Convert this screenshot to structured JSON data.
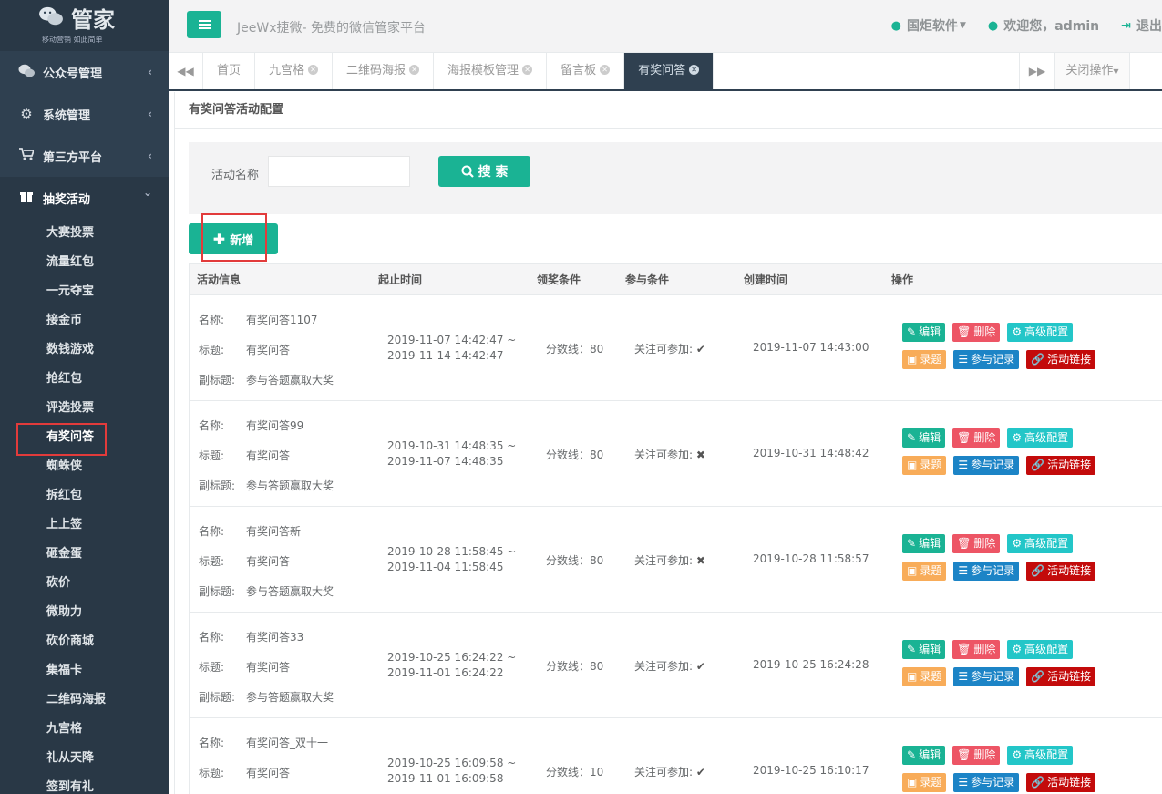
{
  "logo": {
    "brand": "管家",
    "sub": "移动营销 如此简单"
  },
  "sidebar": {
    "menus": [
      {
        "label": "公众号管理",
        "icon": "wechat-icon",
        "arrow": "‹"
      },
      {
        "label": "系统管理",
        "icon": "gear-icon",
        "arrow": "‹"
      },
      {
        "label": "第三方平台",
        "icon": "cart-icon",
        "arrow": "‹"
      },
      {
        "label": "抽奖活动",
        "icon": "gift-icon",
        "arrow": "⌄"
      }
    ],
    "subitems": [
      "大赛投票",
      "流量红包",
      "一元夺宝",
      "接金币",
      "数钱游戏",
      "抢红包",
      "评选投票",
      "有奖问答",
      "蜘蛛侠",
      "拆红包",
      "上上签",
      "砸金蛋",
      "砍价",
      "微助力",
      "砍价商城",
      "集福卡",
      "二维码海报",
      "九宫格",
      "礼从天降",
      "签到有礼"
    ]
  },
  "topbar": {
    "title": "JeeWx捷微- 免费的微信管家平台",
    "company": "国炬软件",
    "welcome": "欢迎您，admin",
    "logout": "退出"
  },
  "tabs": {
    "items": [
      "首页",
      "九宫格",
      "二维码海报",
      "海报模板管理",
      "留言板",
      "有奖问答"
    ],
    "close_ops": "关闭操作"
  },
  "page": {
    "title": "有奖问答活动配置",
    "search_label": "活动名称",
    "search_value": "",
    "search_btn": "搜 索",
    "add_btn": "新增"
  },
  "table": {
    "headers": [
      "活动信息",
      "起止时间",
      "领奖条件",
      "参与条件",
      "创建时间",
      "操作"
    ],
    "labels": {
      "name": "名称:",
      "title": "标题:",
      "subtitle": "副标题:"
    },
    "ops": {
      "edit": "编辑",
      "del": "删除",
      "adv": "高级配置",
      "rec": "录题",
      "log": "参与记录",
      "link": "活动链接"
    },
    "rows": [
      {
        "name": "有奖问答1107",
        "title": "有奖问答",
        "subtitle": "参与答题赢取大奖",
        "start": "2019-11-07 14:42:47 ~",
        "end": "2019-11-14 14:42:47",
        "award": "分数线：80",
        "join": "关注可参加:",
        "join_mark": "✔",
        "created": "2019-11-07 14:43:00"
      },
      {
        "name": "有奖问答99",
        "title": "有奖问答",
        "subtitle": "参与答题赢取大奖",
        "start": "2019-10-31 14:48:35 ~",
        "end": "2019-11-07 14:48:35",
        "award": "分数线：80",
        "join": "关注可参加:",
        "join_mark": "✖",
        "created": "2019-10-31 14:48:42"
      },
      {
        "name": "有奖问答新",
        "title": "有奖问答",
        "subtitle": "参与答题赢取大奖",
        "start": "2019-10-28 11:58:45 ~",
        "end": "2019-11-04 11:58:45",
        "award": "分数线：80",
        "join": "关注可参加:",
        "join_mark": "✖",
        "created": "2019-10-28 11:58:57"
      },
      {
        "name": "有奖问答33",
        "title": "有奖问答",
        "subtitle": "参与答题赢取大奖",
        "start": "2019-10-25 16:24:22 ~",
        "end": "2019-11-01 16:24:22",
        "award": "分数线：80",
        "join": "关注可参加:",
        "join_mark": "✔",
        "created": "2019-10-25 16:24:28"
      },
      {
        "name": "有奖问答_双十一",
        "title": "有奖问答",
        "subtitle": "",
        "start": "2019-10-25 16:09:58 ~",
        "end": "2019-11-01 16:09:58",
        "award": "分数线：10",
        "join": "关注可参加:",
        "join_mark": "✔",
        "created": "2019-10-25 16:10:17"
      }
    ]
  },
  "colors": {
    "sidebar": "#2f4050",
    "primary": "#1ab394",
    "highlight": "#e23b3b"
  }
}
